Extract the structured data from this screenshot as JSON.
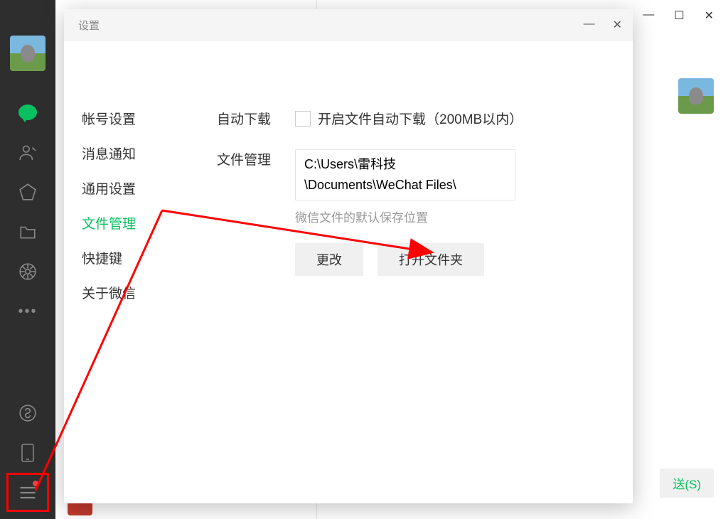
{
  "window": {
    "pin": "⊼",
    "minimize": "—",
    "maximize": "☐",
    "close": "✕"
  },
  "sidebar": {
    "icons": [
      "chat",
      "contacts",
      "favorites",
      "files",
      "moments",
      "more"
    ],
    "bottom_icons": [
      "miniprogram",
      "phone",
      "menu"
    ]
  },
  "chat": {
    "send_button": "送(S)"
  },
  "settings": {
    "title": "设置",
    "minimize": "—",
    "close": "✕",
    "nav": {
      "account": "帐号设置",
      "notification": "消息通知",
      "general": "通用设置",
      "file_management": "文件管理",
      "shortcuts": "快捷键",
      "about": "关于微信"
    },
    "content": {
      "auto_download_label": "自动下载",
      "auto_download_text": "开启文件自动下载（200MB以内）",
      "file_management_label": "文件管理",
      "file_path": "C:\\Users\\雷科技\\Documents\\WeChat Files\\",
      "file_path_hint": "微信文件的默认保存位置",
      "change_button": "更改",
      "open_folder_button": "打开文件夹"
    }
  }
}
